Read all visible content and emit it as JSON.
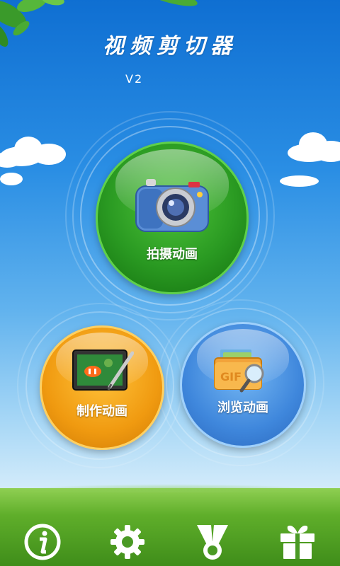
{
  "app": {
    "title": "视频剪切器",
    "version": "V2"
  },
  "actions": {
    "capture": {
      "label": "拍摄动画",
      "icon": "camera-icon"
    },
    "create": {
      "label": "制作动画",
      "icon": "tablet-pen-icon"
    },
    "browse": {
      "label": "浏览动画",
      "icon": "gif-folder-icon"
    }
  },
  "toolbar": [
    {
      "icon": "info-icon"
    },
    {
      "icon": "gear-icon"
    },
    {
      "icon": "share-icon"
    },
    {
      "icon": "gift-icon"
    }
  ],
  "colors": {
    "capture": "#2a9a22",
    "create": "#f09a10",
    "browse": "#3f87dc",
    "sky_top": "#0f6fd2",
    "grass": "#5fae2a"
  }
}
